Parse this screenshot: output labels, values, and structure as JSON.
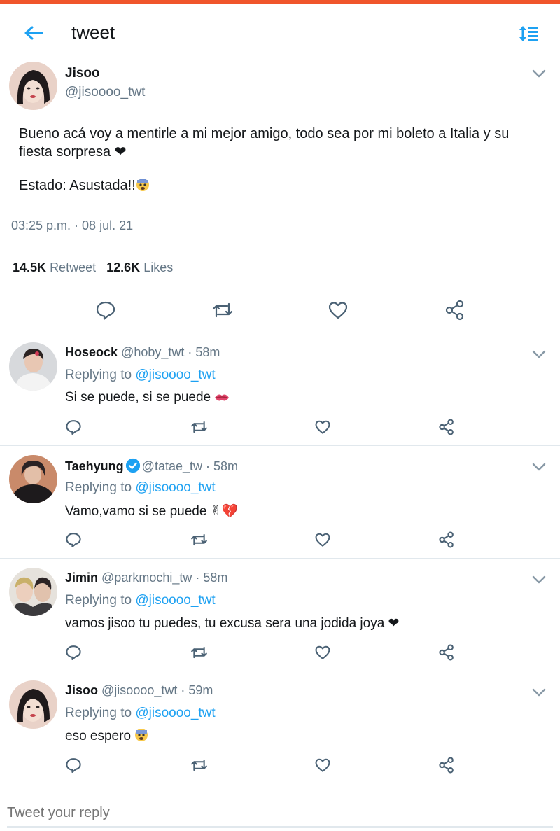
{
  "header": {
    "title": "tweet",
    "back_icon": "back-arrow-icon",
    "sort_icon": "sort-icon",
    "accent_color": "#1da1f2",
    "topbar_color": "#f0552b"
  },
  "main_tweet": {
    "name": "Jisoo",
    "handle": "@jisoooo_twt",
    "text_line1": "Bueno acá voy a mentirle a mi mejor amigo, todo sea por mi boleto a Italia y su fiesta sorpresa ❤",
    "text_line2": "Estado: Asustada!!",
    "timestamp": "03:25 p.m. · 08 jul. 21",
    "retweets_count": "14.5K",
    "retweets_label": "Retweet",
    "likes_count": "12.6K",
    "likes_label": "Likes"
  },
  "replies": [
    {
      "name": "Hoseock",
      "meta": "@hoby_twt · 58m",
      "replying_prefix": "Replying to",
      "replying_handle": "@jisoooo_twt",
      "text": "Si se puede, si se puede",
      "verified": false
    },
    {
      "name": "Taehyung",
      "meta": "@tatae_tw · 58m",
      "replying_prefix": "Replying to",
      "replying_handle": "@jisoooo_twt",
      "text": "Vamo,vamo si se puede ✌💔",
      "verified": true
    },
    {
      "name": "Jimin",
      "meta": "@parkmochi_tw · 58m",
      "replying_prefix": "Replying to",
      "replying_handle": "@jisoooo_twt",
      "text": "vamos jisoo tu puedes, tu excusa sera una jodida joya ❤",
      "verified": false
    },
    {
      "name": "Jisoo",
      "meta": "@jisoooo_twt · 59m",
      "replying_prefix": "Replying to",
      "replying_handle": "@jisoooo_twt",
      "text": "eso espero",
      "verified": false
    }
  ],
  "compose": {
    "placeholder": "Tweet your reply"
  }
}
